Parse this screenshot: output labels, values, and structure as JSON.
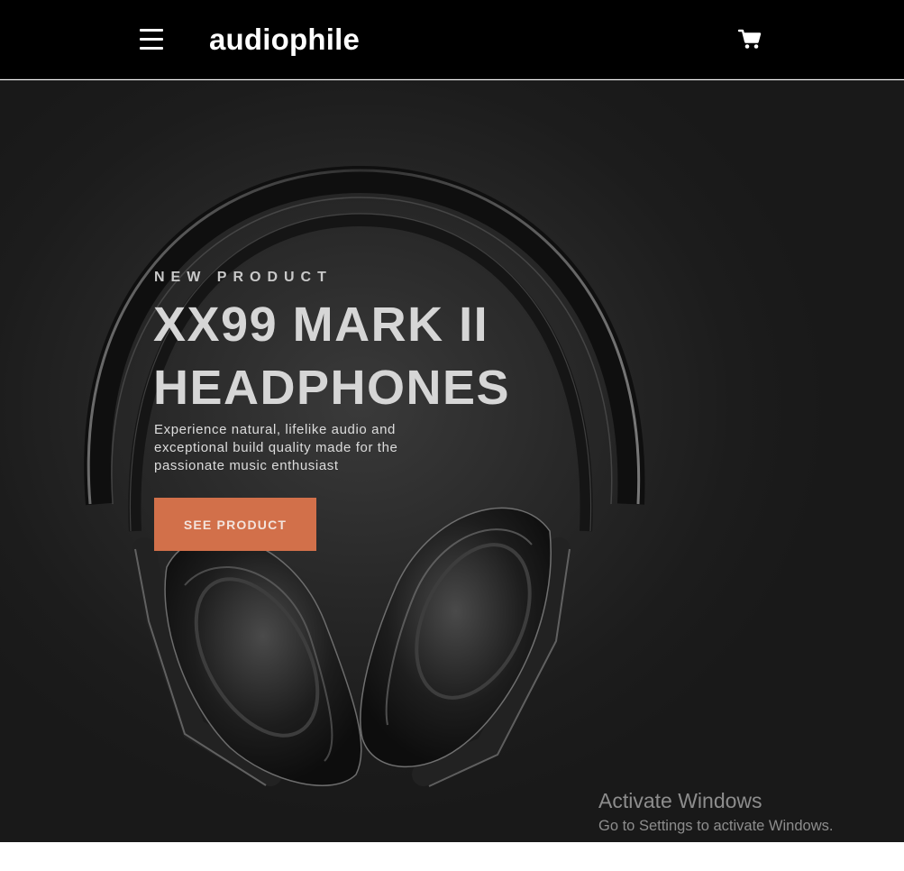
{
  "header": {
    "logo": "audiophile",
    "menu_icon": "hamburger-menu-icon",
    "cart_icon": "shopping-cart-icon"
  },
  "hero": {
    "overline": "NEW PRODUCT",
    "title_line_1": "XX99 MARK II",
    "title_line_2": "HEADPHONES",
    "description": "Experience natural, lifelike audio and exceptional build quality made for the passionate music enthusiast",
    "cta_label": "SEE PRODUCT",
    "image_subject": "headphones-image"
  },
  "watermark": {
    "title": "Activate Windows",
    "subtitle": "Go to Settings to activate Windows."
  },
  "colors": {
    "header_bg": "#000000",
    "hero_bg": "#191919",
    "accent": "#D87D4A",
    "text_light": "#FFFFFF"
  }
}
